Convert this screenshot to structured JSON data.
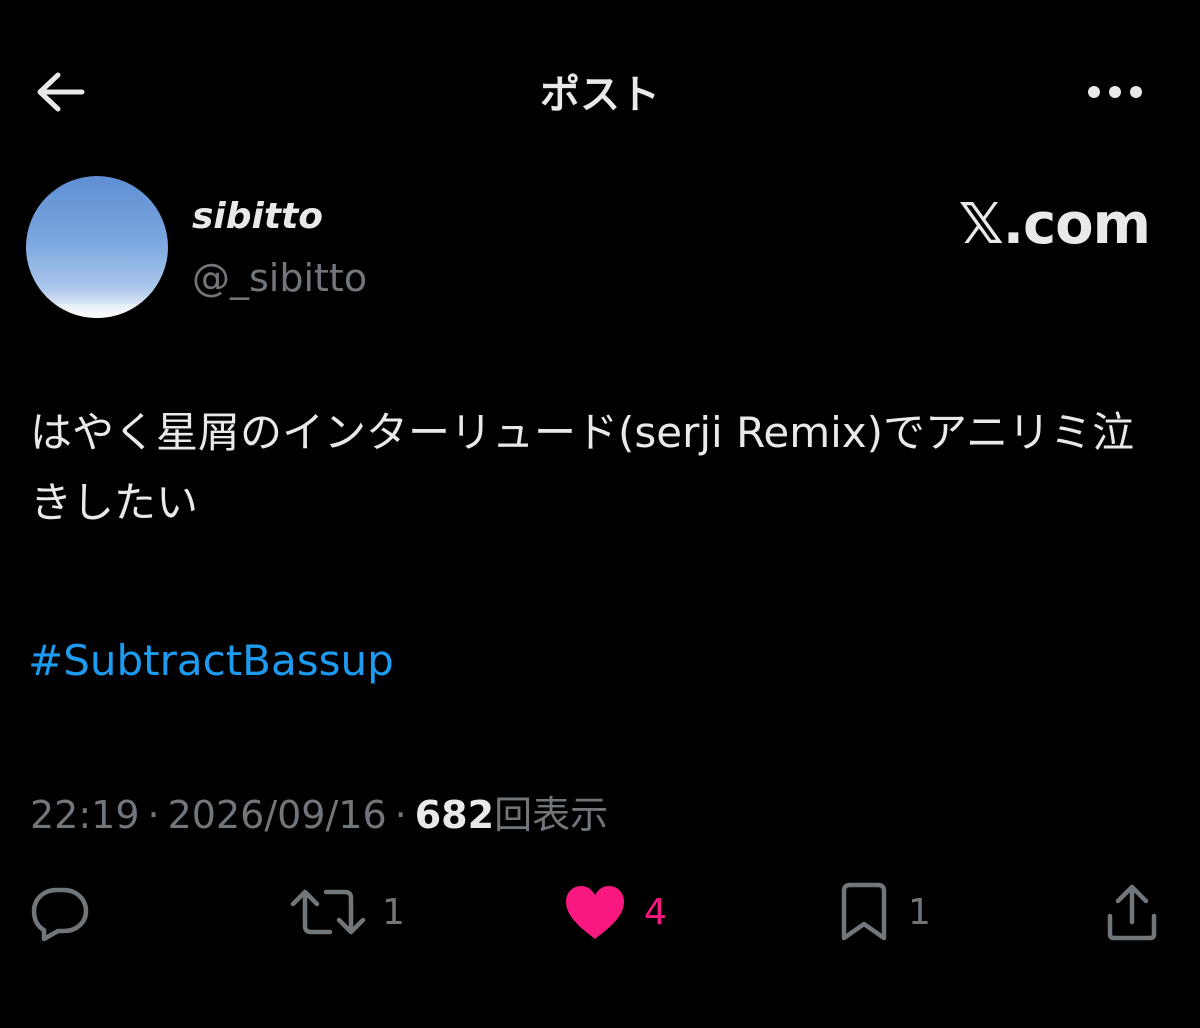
{
  "header": {
    "title": "ポスト",
    "back_icon": "arrow-left-icon",
    "more_icon": "more-horizontal-icon"
  },
  "author": {
    "display_name": "sibitto",
    "handle": "@_sibitto",
    "avatar": "sky-photo-avatar"
  },
  "watermark": "𝕏.com",
  "post": {
    "text": "はやく星屑のインターリュード(serji Remix)でアニリミ泣きしたい",
    "hashtag": "#SubtractBassup"
  },
  "meta": {
    "time": "22:19",
    "date": "2026/09/16",
    "views_count": "682",
    "views_label": "回表示",
    "separator": "·"
  },
  "actions": {
    "reply": {
      "icon": "reply-icon",
      "count": ""
    },
    "repost": {
      "icon": "repost-icon",
      "count": "1"
    },
    "like": {
      "icon": "heart-icon",
      "count": "4",
      "liked": true
    },
    "bookmark": {
      "icon": "bookmark-icon",
      "count": "1"
    },
    "share": {
      "icon": "share-icon"
    }
  },
  "colors": {
    "background": "#000000",
    "text_primary": "#e7e9ea",
    "text_secondary": "#71767b",
    "link": "#1d9bf0",
    "like": "#f91880"
  }
}
